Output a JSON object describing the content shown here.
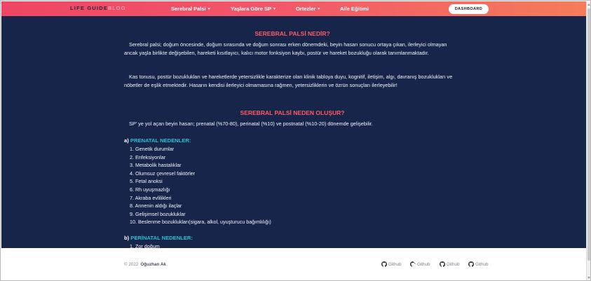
{
  "navbar": {
    "logo_main": "LIFE GUIDE",
    "logo_accent": "BLOG",
    "items": [
      {
        "label": "Serebral Palsi"
      },
      {
        "label": "Yaşlara Göre SP"
      },
      {
        "label": "Ortezler"
      },
      {
        "label": "Aile Eğitimi"
      }
    ],
    "dashboard_label": "DASHBOARD",
    "brand_colors": {
      "gradient_start": "#ee4664",
      "gradient_end": "#f57c5a"
    }
  },
  "section1": {
    "heading": "SEREBRAL PALSİ NEDİR?",
    "paragraph1": "Serebral palsi; doğum öncesinde, doğum sırasında ve doğum sonrası erken dönemdeki, beyin hasarı sonucu ortaya çıkan, ilerleyici olmayan ancak yaşla birlikte değişebilen, hareketi kısıtlayıcı, kalıcı motor fonksiyon kaybı, postür ve hareket bozukluğu olarak tanımlanmaktadır.",
    "paragraph2": "Kas tonusu, postür bozuklukları ve hareketlerde yetersizlikle karakterize olan klinik tabloya duyu, kognitif, iletişim, algı, davranış bozuklukları ve nöbetler de eşlik etmektedir. Hasarın kendisi ilerleyici olmamasına rağmen, yetersizliklerin ve özrün sonuçları ilerleyebilir!"
  },
  "section2": {
    "heading": "SEREBRAL PALSİ NEDEN OLUŞUR?",
    "intro": "SP' ye yol açan beyin hasarı; prenatal (%70-80), perinatal (%10) ve postnatal (%10-20) dönemde gelişebilir.",
    "prenatal_prefix": "a)",
    "prenatal_title": "PRENATAL NEDENLER:",
    "prenatal_items": [
      "1. Genetik durumlar",
      "2. Enfeksiyonlar",
      "3. Metabolik hastalıklar",
      "4. Olumsuz çevresel faktörler",
      "5. Fetal anoksi",
      "6. Rh uyuşmazlığı",
      "7. Akraba evlilikleri",
      "8. Annenin aldığı ilaçlar",
      "9. Gelişimsel bozukluklar",
      "10. Beslenme bozuklukları(sigara, alkol, uyuşturucu bağımlılığı)"
    ],
    "perinatal_prefix": "b)",
    "perinatal_title": "PERİNATAL NEDENLER:",
    "perinatal_items": [
      "1. Zor doğum"
    ]
  },
  "footer": {
    "copyright": "© 2022",
    "author": "Oğuzhan Ak",
    "links": [
      {
        "label": "Github",
        "icon": "github-icon"
      },
      {
        "label": "Github",
        "icon": "github-icon"
      },
      {
        "label": "Github",
        "icon": "github-icon"
      },
      {
        "label": "Github",
        "icon": "github-icon"
      }
    ]
  },
  "colors": {
    "content_bg": "#17254a",
    "heading": "#ff5a64",
    "subheading_accent": "#27c2d4"
  }
}
